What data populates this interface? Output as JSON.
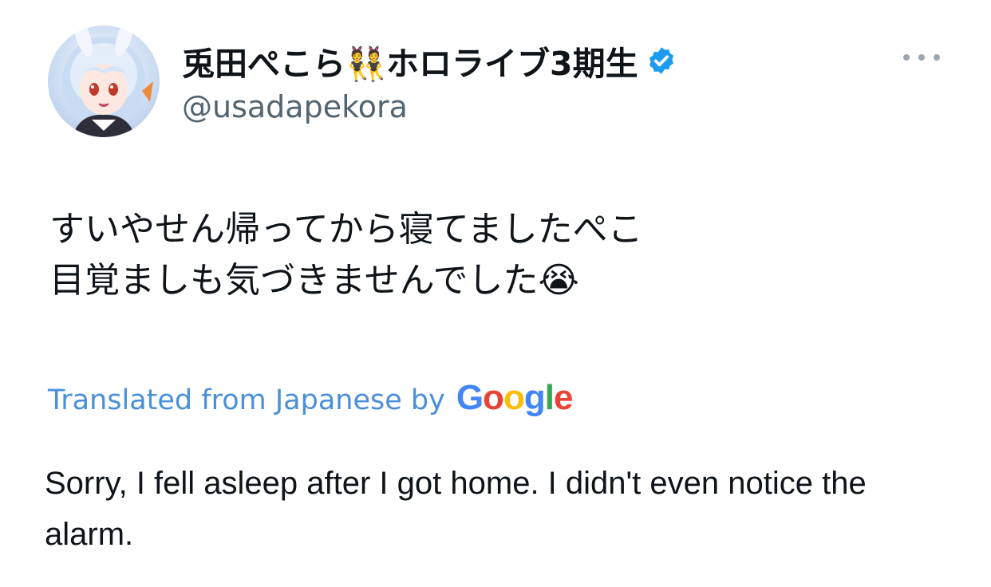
{
  "author": {
    "display_name": "兎田ぺこら👯ホロライブ3期生",
    "handle": "@usadapekora",
    "verified": true,
    "avatar_icon": "avatar-image"
  },
  "tweet": {
    "text_lines": [
      "すいやせん帰ってから寝てましたぺこ",
      "目覚ましも気づきませんでした😭"
    ]
  },
  "translation": {
    "label": "Translated from Japanese by",
    "provider": "Google",
    "text": "Sorry, I fell asleep after I got home. I didn't even notice the alarm."
  },
  "menu": {
    "icon": "more-options-icon"
  },
  "colors": {
    "link": "#4a90d9",
    "verified_badge": "#1d9bf0",
    "handle_gray": "#536471"
  }
}
